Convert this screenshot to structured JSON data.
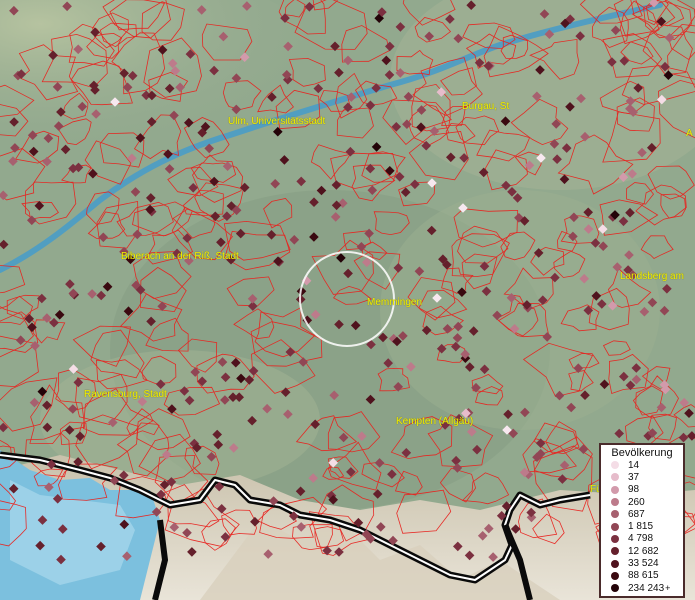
{
  "cities": [
    {
      "id": "ulm",
      "label": "Ulm, Universitätsstadt"
    },
    {
      "id": "burgau",
      "label": "Burgau, St"
    },
    {
      "id": "biberach",
      "label": "Biberach an der Riß, Stadt"
    },
    {
      "id": "landsberg",
      "label": "Landsberg am"
    },
    {
      "id": "memmingen",
      "label": "Memmingen"
    },
    {
      "id": "ravensburg",
      "label": "Ravensburg, Stadt"
    },
    {
      "id": "kempten",
      "label": "Kempten (Allgäu)"
    },
    {
      "id": "fu",
      "label": "Fü"
    },
    {
      "id": "edge_a",
      "label": "A"
    }
  ],
  "legend": {
    "title": "Bevölkerung",
    "items": [
      {
        "label": "14",
        "color": "#f4dde6"
      },
      {
        "label": "37",
        "color": "#e6bccb"
      },
      {
        "label": "98",
        "color": "#d29aab"
      },
      {
        "label": "260",
        "color": "#bd7b8b"
      },
      {
        "label": "687",
        "color": "#a7606f"
      },
      {
        "label": "1 815",
        "color": "#914655"
      },
      {
        "label": "4 798",
        "color": "#7b3040"
      },
      {
        "label": "12 682",
        "color": "#65202c"
      },
      {
        "label": "33 524",
        "color": "#4f121d"
      },
      {
        "label": "88 615",
        "color": "#3a0910"
      },
      {
        "label": "234 243",
        "color": "#230308",
        "plus": "+"
      }
    ]
  },
  "colors": {
    "boundary": "#e8231f",
    "lake": "#4aa0c8",
    "river": "#4a9cc7",
    "border": "#0a0a0a",
    "label": "#f2f000"
  }
}
